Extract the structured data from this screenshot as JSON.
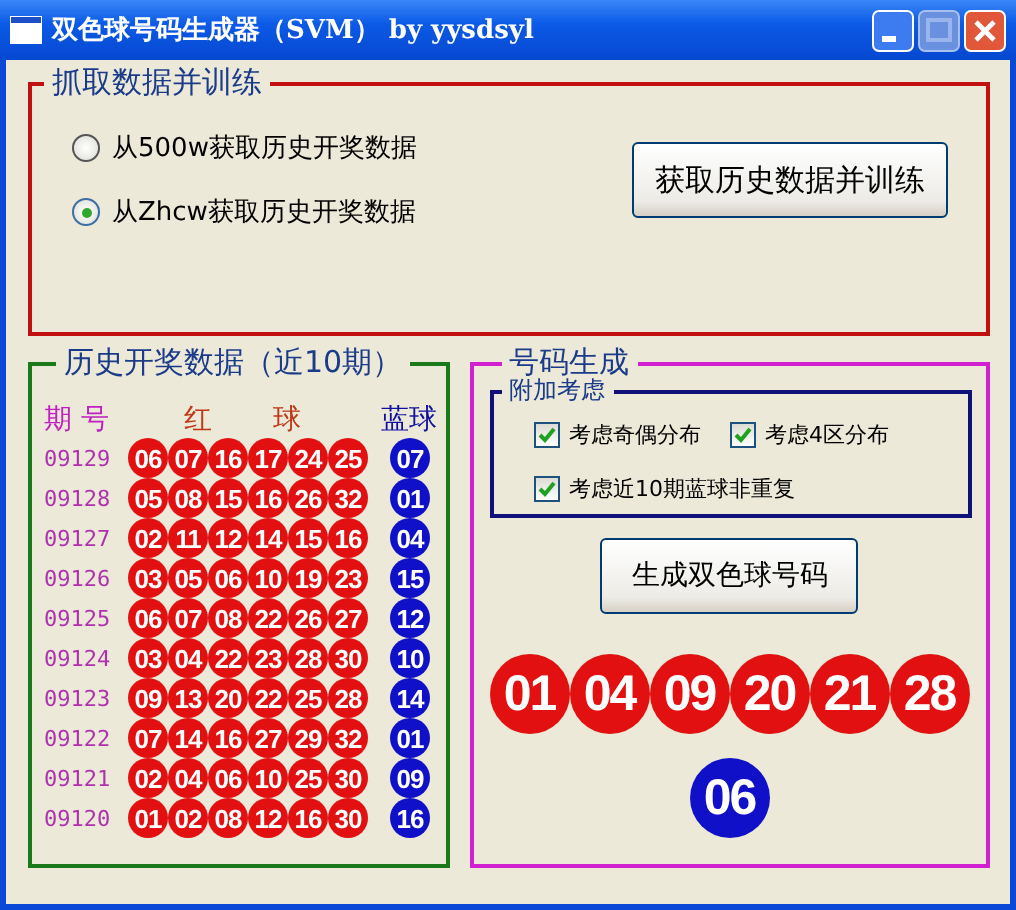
{
  "window": {
    "title": "双色球号码生成器（SVM） by yysdsyl"
  },
  "fetch": {
    "title": "抓取数据并训练",
    "sources": [
      {
        "label": "从500w获取历史开奖数据",
        "selected": false
      },
      {
        "label": "从Zhcw获取历史开奖数据",
        "selected": true
      }
    ],
    "button": "获取历史数据并训练"
  },
  "history": {
    "title": "历史开奖数据（近10期）",
    "headers": [
      {
        "kind": "issue",
        "label": "期 号"
      },
      {
        "kind": "red",
        "label": "红"
      },
      {
        "kind": "red",
        "label": "球"
      },
      {
        "kind": "blue",
        "label": "蓝球"
      }
    ],
    "rows": [
      {
        "issue": "09129",
        "red": [
          "06",
          "07",
          "16",
          "17",
          "24",
          "25"
        ],
        "blue": "07"
      },
      {
        "issue": "09128",
        "red": [
          "05",
          "08",
          "15",
          "16",
          "26",
          "32"
        ],
        "blue": "01"
      },
      {
        "issue": "09127",
        "red": [
          "02",
          "11",
          "12",
          "14",
          "15",
          "16"
        ],
        "blue": "04"
      },
      {
        "issue": "09126",
        "red": [
          "03",
          "05",
          "06",
          "10",
          "19",
          "23"
        ],
        "blue": "15"
      },
      {
        "issue": "09125",
        "red": [
          "06",
          "07",
          "08",
          "22",
          "26",
          "27"
        ],
        "blue": "12"
      },
      {
        "issue": "09124",
        "red": [
          "03",
          "04",
          "22",
          "23",
          "28",
          "30"
        ],
        "blue": "10"
      },
      {
        "issue": "09123",
        "red": [
          "09",
          "13",
          "20",
          "22",
          "25",
          "28"
        ],
        "blue": "14"
      },
      {
        "issue": "09122",
        "red": [
          "07",
          "14",
          "16",
          "27",
          "29",
          "32"
        ],
        "blue": "01"
      },
      {
        "issue": "09121",
        "red": [
          "02",
          "04",
          "06",
          "10",
          "25",
          "30"
        ],
        "blue": "09"
      },
      {
        "issue": "09120",
        "red": [
          "01",
          "02",
          "08",
          "12",
          "16",
          "30"
        ],
        "blue": "16"
      }
    ]
  },
  "generate": {
    "title": "号码生成",
    "options_title": "附加考虑",
    "options": [
      {
        "label": "考虑奇偶分布",
        "checked": true
      },
      {
        "label": "考虑4区分布",
        "checked": true
      },
      {
        "label": "考虑近10期蓝球非重复",
        "checked": true
      }
    ],
    "button": "生成双色球号码",
    "result": {
      "red": [
        "01",
        "04",
        "09",
        "20",
        "21",
        "28"
      ],
      "blue": "06"
    }
  }
}
